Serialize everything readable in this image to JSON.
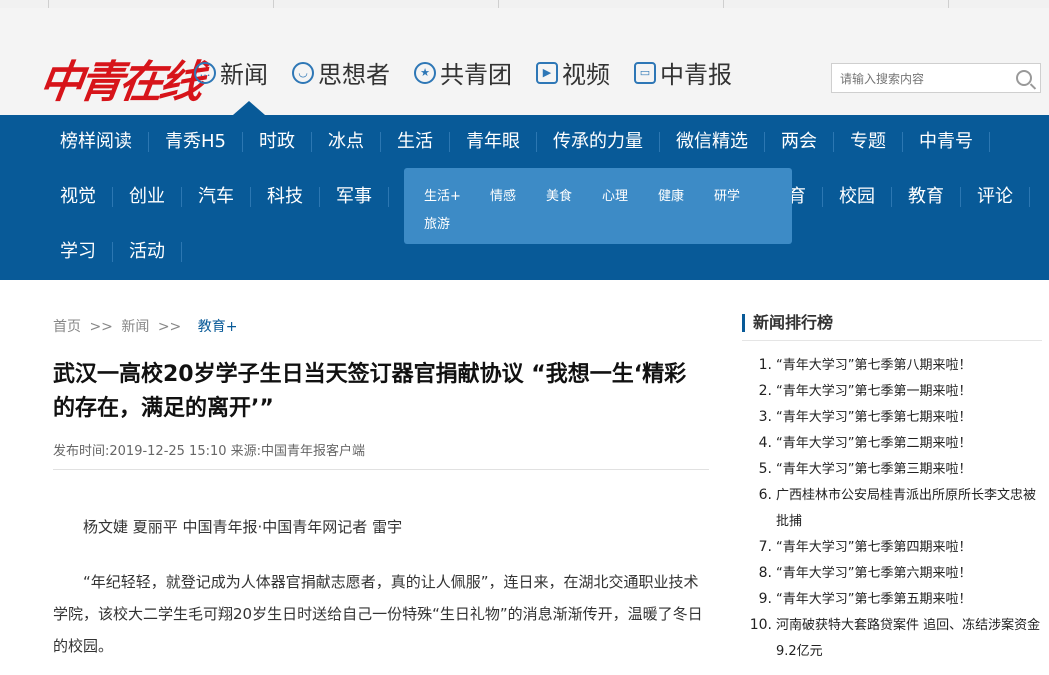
{
  "logo": "中青在线",
  "channels": [
    {
      "label": "新闻",
      "icon": "chat-icon"
    },
    {
      "label": "思想者",
      "icon": "bulb-icon"
    },
    {
      "label": "共青团",
      "icon": "star-icon"
    },
    {
      "label": "视频",
      "icon": "tv-icon"
    },
    {
      "label": "中青报",
      "icon": "newspaper-icon"
    }
  ],
  "search": {
    "placeholder": "请输入搜索内容"
  },
  "nav": {
    "row1": [
      "榜样阅读",
      "青秀H5",
      "时政",
      "冰点",
      "生活",
      "青年眼",
      "传承的力量",
      "微信精选",
      "两会",
      "专题",
      "中青号"
    ],
    "row2": [
      "视觉",
      "创业",
      "汽车",
      "科技",
      "军事",
      "育",
      "校园",
      "教育",
      "评论"
    ],
    "row3": [
      "学习",
      "活动"
    ],
    "dropdown": [
      "生活+",
      "情感",
      "美食",
      "心理",
      "健康",
      "研学",
      "旅游"
    ]
  },
  "breadcrumb": {
    "home": "首页",
    "sep": ">>",
    "news": "新闻",
    "current": "教育+"
  },
  "article": {
    "title": "武汉一高校20岁学子生日当天签订器官捐献协议 “我想一生‘精彩的存在，满足的离开’”",
    "meta": "发布时间:2019-12-25 15:10  来源:中国青年报客户端",
    "byline": "杨文婕 夏丽平 中国青年报·中国青年网记者 雷宇",
    "para1": "“年纪轻轻，就登记成为人体器官捐献志愿者，真的让人佩服”，连日来，在湖北交通职业技术学院，该校大二学生毛可翔20岁生日时送给自己一份特殊“生日礼物”的消息渐渐传开，温暖了冬日的校园。"
  },
  "ranking": {
    "title": "新闻排行榜",
    "items": [
      {
        "num": "1.",
        "text": "“青年大学习”第七季第八期来啦！"
      },
      {
        "num": "2.",
        "text": "“青年大学习”第七季第一期来啦！"
      },
      {
        "num": "3.",
        "text": "“青年大学习”第七季第七期来啦！"
      },
      {
        "num": "4.",
        "text": "“青年大学习”第七季第二期来啦！"
      },
      {
        "num": "5.",
        "text": "“青年大学习”第七季第三期来啦！"
      },
      {
        "num": "6.",
        "text": "广西桂林市公安局桂青派出所原所长李文忠被批捕"
      },
      {
        "num": "7.",
        "text": "“青年大学习”第七季第四期来啦！"
      },
      {
        "num": "8.",
        "text": "“青年大学习”第七季第六期来啦！"
      },
      {
        "num": "9.",
        "text": "“青年大学习”第七季第五期来啦！"
      },
      {
        "num": "10.",
        "text": "河南破获特大套路贷案件 追回、冻结涉案资金9.2亿元"
      }
    ]
  },
  "colors": {
    "brand_red": "#d7141a",
    "nav_blue": "#085a98",
    "dropdown_blue": "#3d8bc6"
  }
}
